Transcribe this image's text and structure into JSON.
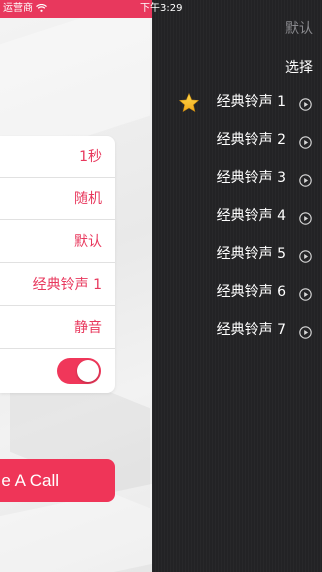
{
  "status_bar": {
    "carrier": "运营商",
    "wifi_icon": "wifi-icon",
    "time": "下午3:29"
  },
  "app": {
    "settings": [
      {
        "value": "1秒"
      },
      {
        "value": "随机"
      },
      {
        "value": "默认"
      },
      {
        "value": "经典铃声 1"
      },
      {
        "value": "静音"
      },
      {
        "toggle": true
      }
    ],
    "call_button_label": "e A Call",
    "accent_color": "#e8385d"
  },
  "menu": {
    "default_label": "默认",
    "select_label": "选择",
    "selected_icon": "star-icon",
    "play_icon": "play-circle-icon",
    "ringtones": [
      {
        "label": "经典铃声 1",
        "selected": true
      },
      {
        "label": "经典铃声 2",
        "selected": false
      },
      {
        "label": "经典铃声 3",
        "selected": false
      },
      {
        "label": "经典铃声 4",
        "selected": false
      },
      {
        "label": "经典铃声 5",
        "selected": false
      },
      {
        "label": "经典铃声 6",
        "selected": false
      },
      {
        "label": "经典铃声 7",
        "selected": false
      }
    ]
  }
}
